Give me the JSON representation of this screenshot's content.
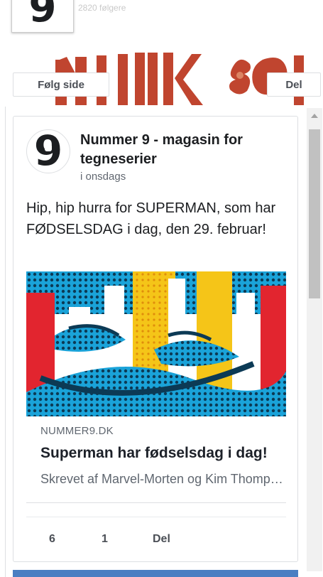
{
  "header": {
    "likes_text": "2820 følgere",
    "logo_glyph": "9",
    "follow_label": "Følg side",
    "share_label": "Del"
  },
  "post": {
    "avatar_glyph": "9",
    "page_name": "Nummer 9 - magasin for tegneserier",
    "time": "i onsdags",
    "text": "Hip, hip hurra for SUPERMAN, som har FØDSELSDAG i dag, den 29. februar!",
    "link": {
      "domain": "NUMMER9.DK",
      "title": "Superman har fødselsdag i dag!",
      "description": "Skrevet af Marvel-Morten og Kim Thompson"
    },
    "actions": {
      "like_count": "6",
      "comment_count": "1",
      "share_label": "Del"
    }
  },
  "colors": {
    "accent_blue": "#4a7ec2",
    "cover_red": "#c0392b",
    "art_yellow": "#f5c518",
    "art_cyan": "#1aa3d9",
    "art_red": "#e2252f"
  }
}
